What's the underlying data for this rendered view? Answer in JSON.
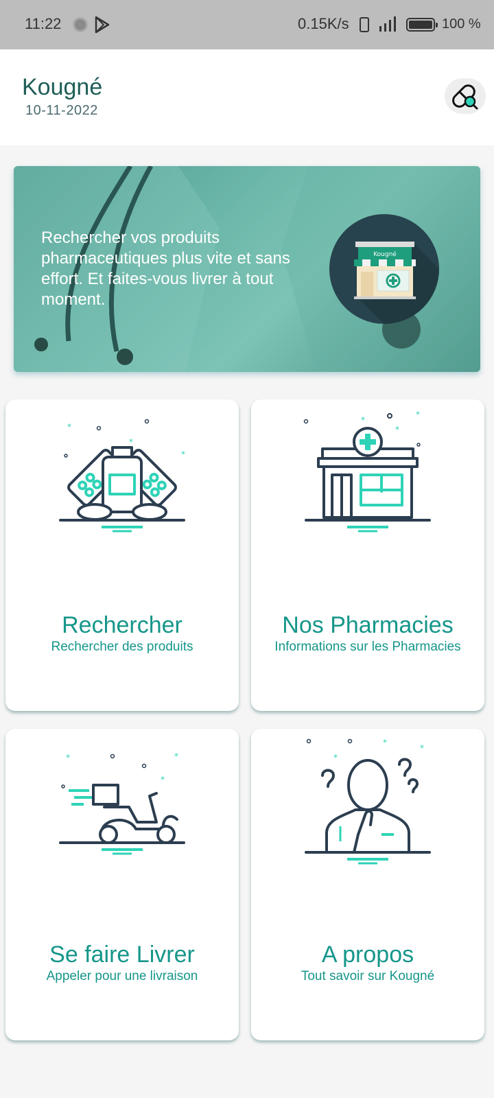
{
  "status_bar": {
    "time": "11:22",
    "net_speed": "0.15K/s",
    "battery": "100 %"
  },
  "header": {
    "title": "Kougné",
    "date": "10-11-2022",
    "search_icon": "pill-search-icon"
  },
  "banner": {
    "text": "Rechercher vos produits pharmaceutiques plus vite et sans effort. Et faites-vous livrer à tout moment.",
    "store_sign": "Kougné"
  },
  "cards": [
    {
      "title": "Rechercher",
      "subtitle": "Rechercher des produits",
      "icon": "medicine-icon"
    },
    {
      "title": "Nos Pharmacies",
      "subtitle": "Informations sur les Pharmacies",
      "icon": "pharmacy-icon"
    },
    {
      "title": "Se faire Livrer",
      "subtitle": "Appeler pour une livraison",
      "icon": "delivery-scooter-icon"
    },
    {
      "title": "A propos",
      "subtitle": "Tout savoir sur Kougné",
      "icon": "question-person-icon"
    }
  ],
  "colors": {
    "accent": "#15968a",
    "dark_navy": "#2c3e50",
    "mint": "#2ed3b7",
    "title_green": "#1f5e57"
  }
}
